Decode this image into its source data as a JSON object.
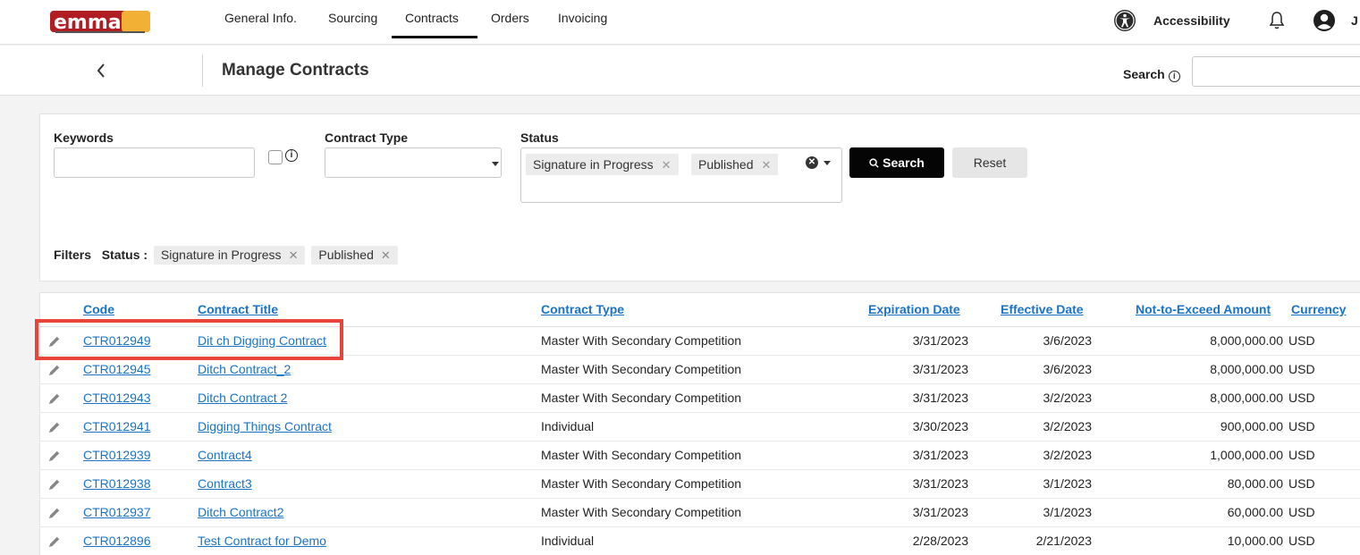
{
  "nav": {
    "items": [
      "General Info.",
      "Sourcing",
      "Contracts",
      "Orders",
      "Invoicing"
    ],
    "active": "Contracts",
    "accessibility_label": "Accessibility",
    "user_initial": "J"
  },
  "subheader": {
    "title": "Manage Contracts",
    "search_label": "Search"
  },
  "filters": {
    "keywords_label": "Keywords",
    "contract_type_label": "Contract Type",
    "status_label": "Status",
    "status_chips": [
      "Signature in Progress",
      "Published"
    ],
    "search_button": "Search",
    "reset_button": "Reset",
    "applied_label": "Filters",
    "applied_status_label": "Status :",
    "applied_chips": [
      "Signature in Progress",
      "Published"
    ]
  },
  "table": {
    "columns": [
      "Code",
      "Contract Title",
      "Contract Type",
      "Expiration Date",
      "Effective Date",
      "Not-to-Exceed Amount",
      "Currency"
    ],
    "rows": [
      {
        "code": "CTR012949",
        "title": "Dit ch Digging Contract",
        "type": "Master With Secondary Competition",
        "expiration": "3/31/2023",
        "effective": "3/6/2023",
        "amount": "8,000,000.00",
        "currency": "USD"
      },
      {
        "code": "CTR012945",
        "title": "Ditch Contract_2",
        "type": "Master With Secondary Competition",
        "expiration": "3/31/2023",
        "effective": "3/6/2023",
        "amount": "8,000,000.00",
        "currency": "USD"
      },
      {
        "code": "CTR012943",
        "title": "Ditch Contract 2",
        "type": "Master With Secondary Competition",
        "expiration": "3/31/2023",
        "effective": "3/2/2023",
        "amount": "8,000,000.00",
        "currency": "USD"
      },
      {
        "code": "CTR012941",
        "title": "Digging Things Contract",
        "type": "Individual",
        "expiration": "3/30/2023",
        "effective": "3/2/2023",
        "amount": "900,000.00",
        "currency": "USD"
      },
      {
        "code": "CTR012939",
        "title": "Contract4",
        "type": "Master With Secondary Competition",
        "expiration": "3/31/2023",
        "effective": "3/2/2023",
        "amount": "1,000,000.00",
        "currency": "USD"
      },
      {
        "code": "CTR012938",
        "title": "Contract3",
        "type": "Master With Secondary Competition",
        "expiration": "3/31/2023",
        "effective": "3/1/2023",
        "amount": "80,000.00",
        "currency": "USD"
      },
      {
        "code": "CTR012937",
        "title": "Ditch Contract2",
        "type": "Master With Secondary Competition",
        "expiration": "3/31/2023",
        "effective": "3/1/2023",
        "amount": "60,000.00",
        "currency": "USD"
      },
      {
        "code": "CTR012896",
        "title": "Test Contract for Demo",
        "type": "Individual",
        "expiration": "2/28/2023",
        "effective": "2/21/2023",
        "amount": "10,000.00",
        "currency": "USD"
      }
    ]
  },
  "icons": {
    "logo": "emma-logo",
    "accessibility": "accessibility-icon",
    "notifications": "bell-icon",
    "user": "user-icon",
    "back": "chevron-left-icon",
    "edit": "pencil-icon"
  },
  "colors": {
    "link": "#1a73c8",
    "highlight": "#e8443a",
    "primary_button": "#050505"
  }
}
